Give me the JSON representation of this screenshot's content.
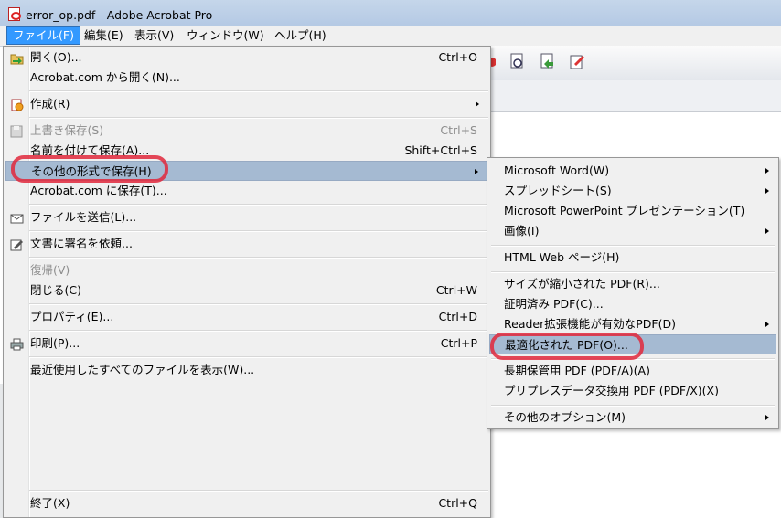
{
  "window": {
    "title": "error_op.pdf - Adobe Acrobat Pro"
  },
  "menubar": {
    "items": [
      "ファイル(F)",
      "編集(E)",
      "表示(V)",
      "ウィンドウ(W)",
      "ヘルプ(H)"
    ],
    "active": "ファイル(F)"
  },
  "file_menu": {
    "items": [
      {
        "label": "開く(O)...",
        "shortcut": "Ctrl+O",
        "icon": "open-folder-icon"
      },
      {
        "label": "Acrobat.com から開く(N)...",
        "shortcut": ""
      },
      {
        "label": "作成(R)",
        "submenu": true,
        "icon": "create-pdf-icon"
      },
      {
        "label": "上書き保存(S)",
        "shortcut": "Ctrl+S",
        "disabled": true,
        "icon": "save-disk-icon"
      },
      {
        "label": "名前を付けて保存(A)...",
        "shortcut": "Shift+Ctrl+S"
      },
      {
        "label": "その他の形式で保存(H)",
        "submenu": true,
        "highlighted": true
      },
      {
        "label": "Acrobat.com に保存(T)...",
        "shortcut": ""
      },
      {
        "label": "ファイルを送信(L)...",
        "icon": "envelope-icon"
      },
      {
        "label": "文書に署名を依頼...",
        "icon": "sign-request-icon"
      },
      {
        "label": "復帰(V)",
        "disabled": true
      },
      {
        "label": "閉じる(C)",
        "shortcut": "Ctrl+W"
      },
      {
        "label": "プロパティ(E)...",
        "shortcut": "Ctrl+D"
      },
      {
        "label": "印刷(P)...",
        "shortcut": "Ctrl+P",
        "icon": "printer-icon"
      },
      {
        "label": "最近使用したすべてのファイルを表示(W)..."
      },
      {
        "label": "終了(X)",
        "shortcut": "Ctrl+Q"
      }
    ]
  },
  "save_as_other_submenu": {
    "items": [
      {
        "label": "Microsoft Word(W)",
        "submenu": true
      },
      {
        "label": "スプレッドシート(S)",
        "submenu": true
      },
      {
        "label": "Microsoft PowerPoint プレゼンテーション(T)"
      },
      {
        "label": "画像(I)",
        "submenu": true
      },
      {
        "label": "HTML Web ページ(H)"
      },
      {
        "label": "サイズが縮小された PDF(R)..."
      },
      {
        "label": "証明済み PDF(C)..."
      },
      {
        "label": "Reader拡張機能が有効なPDF(D)",
        "submenu": true
      },
      {
        "label": "最適化された PDF(O)...",
        "highlighted": true
      },
      {
        "label": "長期保管用 PDF (PDF/A)(A)"
      },
      {
        "label": "プリプレスデータ交換用 PDF (PDF/X)(X)"
      },
      {
        "label": "その他のオプション(M)",
        "submenu": true
      }
    ]
  },
  "colors": {
    "menu_bg": "#f0f0f0",
    "highlight": "#a5bad2",
    "menubar_active": "#3399ff",
    "annotation_marker": "#e1283c"
  }
}
